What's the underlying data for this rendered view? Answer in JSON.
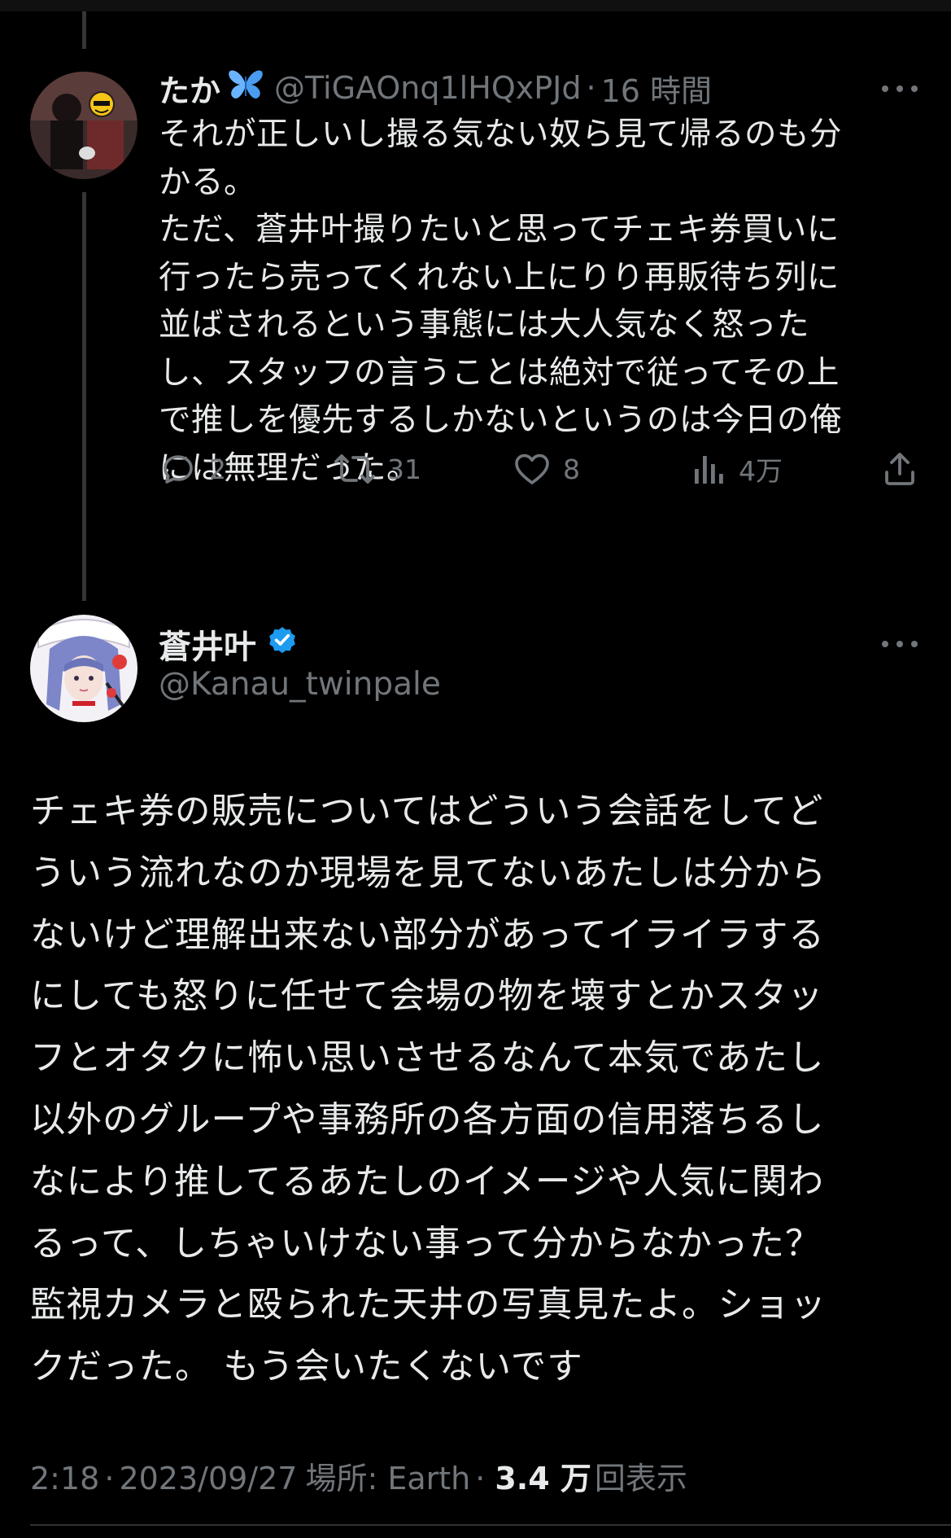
{
  "reply": {
    "name": "たか",
    "name_emoji": "butterfly-emoji",
    "handle": "@TiGAOnq1lHQxPJd",
    "separator": "·",
    "time": "16 時間",
    "text_lines": [
      "それが正しいし撮る気ない奴ら見て帰るのも分",
      "かる。",
      "ただ、蒼井叶撮りたいと思ってチェキ券買いに",
      "行ったら売ってくれない上にりり再販待ち列に",
      "並ばされるという事態には大人気なく怒った",
      "し、スタッフの言うことは絶対で従ってその上",
      "で推しを優先するしかないというのは今日の俺",
      "には無理だった。"
    ],
    "actions": {
      "replies": "2",
      "retweets": "31",
      "likes": "8",
      "views": "4万"
    }
  },
  "main": {
    "name": "蒼井叶",
    "verified": true,
    "handle": "@Kanau_twinpale",
    "text_lines": [
      "チェキ券の販売についてはどういう会話をしてど",
      "ういう流れなのか現場を見てないあたしは分から",
      "ないけど理解出来ない部分があってイライラする",
      "にしても怒りに任せて会場の物を壊すとかスタッ",
      "フとオタクに怖い思いさせるなんて本気であたし",
      "以外のグループや事務所の各方面の信用落ちるし",
      "なにより推してるあたしのイメージや人気に関わ",
      "るって、しちゃいけない事って分からなかった？",
      "監視カメラと殴られた天井の写真見たよ。ショッ",
      "クだった。 もう会いたくないです"
    ],
    "meta": {
      "time": "2:18",
      "date": "2023/09/27",
      "location_label": "場所: Earth",
      "separator": "·",
      "views_count": "3.4 万",
      "views_label": "回表示"
    }
  },
  "colors": {
    "background": "#000000",
    "text": "#e7e9ea",
    "muted": "#71767b",
    "verified": "#1d9bf0",
    "butterfly": "#6ab4ff"
  }
}
